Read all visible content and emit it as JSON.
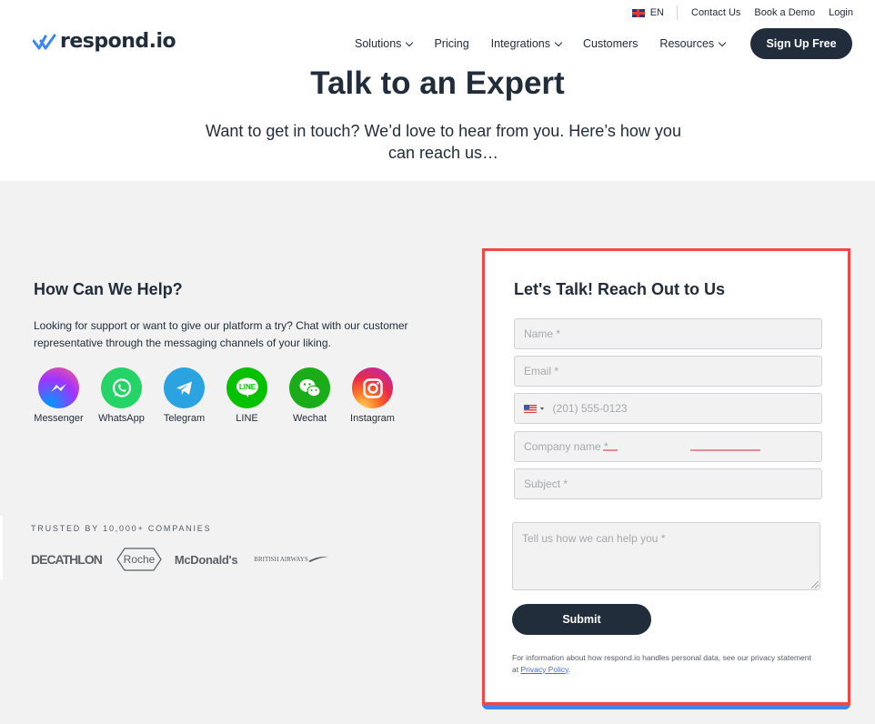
{
  "topbar": {
    "language": "EN",
    "links": [
      "Contact Us",
      "Book a Demo",
      "Login"
    ]
  },
  "brand": {
    "name": "respond.io",
    "accent_color": "#3b86f7"
  },
  "nav": {
    "items": [
      {
        "label": "Solutions",
        "dropdown": true
      },
      {
        "label": "Pricing",
        "dropdown": false
      },
      {
        "label": "Integrations",
        "dropdown": true
      },
      {
        "label": "Customers",
        "dropdown": false
      },
      {
        "label": "Resources",
        "dropdown": true
      }
    ],
    "cta": "Sign Up Free"
  },
  "hero": {
    "title": "Talk to an Expert",
    "subtitle": "Want to get in touch? We’d love to hear from you. Here’s how you can reach us…"
  },
  "help": {
    "title": "How Can We Help?",
    "description": "Looking for support or want to give our platform a try? Chat with our customer representative through the messaging channels of your liking.",
    "channels": [
      {
        "label": "Messenger",
        "icon": "messenger-icon"
      },
      {
        "label": "WhatsApp",
        "icon": "whatsapp-icon"
      },
      {
        "label": "Telegram",
        "icon": "telegram-icon"
      },
      {
        "label": "LINE",
        "icon": "line-icon",
        "icon_text": "LINE"
      },
      {
        "label": "Wechat",
        "icon": "wechat-icon"
      },
      {
        "label": "Instagram",
        "icon": "instagram-icon"
      }
    ]
  },
  "trusted": {
    "label": "TRUSTED BY 10,000+ COMPANIES",
    "logos": [
      "DECATHLON",
      "Roche",
      "McDonald's",
      "BRITISH AIRWAYS"
    ]
  },
  "form": {
    "title": "Let's Talk! Reach Out to Us",
    "name_placeholder": "Name *",
    "email_placeholder": "Email *",
    "phone_placeholder": "(201) 555-0123",
    "phone_country": "US",
    "company_placeholder": "Company name *",
    "subject_placeholder": "Subject *",
    "message_placeholder": "Tell us how we can help you *",
    "submit": "Submit",
    "privacy_text": "For information about how respond.io handles personal data, see our privacy statement at ",
    "privacy_link": "Privacy Policy",
    "privacy_end": ".",
    "highlight_color": "#f24747"
  }
}
